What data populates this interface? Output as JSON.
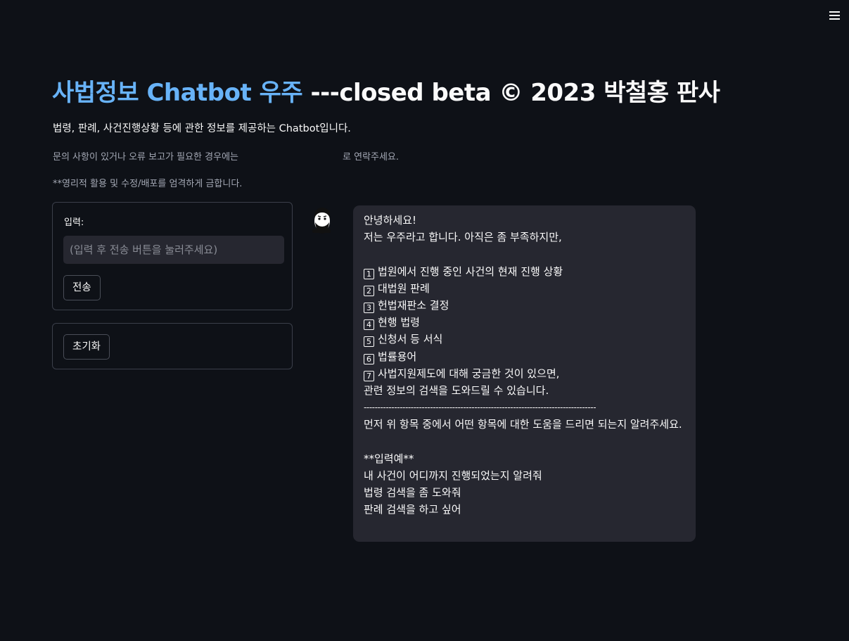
{
  "header": {
    "menu_icon": "hamburger-menu-icon"
  },
  "title": {
    "part1": "사법정보 Chatbot 우주",
    "part2": " ---closed beta © 2023 박철홍 판사",
    "accent_color": "#68b3f8"
  },
  "subtitle": "법령, 판례, 사건진행상황 등에 관한 정보를 제공하는 Chatbot입니다.",
  "contact": {
    "before": "문의 사항이 있거나 오류 보고가 필요한 경우에는",
    "after": "로 연락주세요."
  },
  "notice": "**영리적 활용 및 수정/배포를 엄격하게 금합니다.",
  "form": {
    "input_label": "입력:",
    "input_placeholder": "(입력 후 전송 버튼을 눌러주세요)",
    "input_value": "",
    "send_label": "전송"
  },
  "reset": {
    "label": "초기화"
  },
  "chat": {
    "avatar_icon": "bearded-man-avatar-icon",
    "greeting": "안녕하세요!",
    "intro": "저는 우주라고 합니다. 아직은 좀 부족하지만,",
    "items": [
      {
        "num": "1",
        "text": "법원에서 진행 중인 사건의 현재 진행 상황"
      },
      {
        "num": "2",
        "text": "대법원 판례"
      },
      {
        "num": "3",
        "text": "헌법재판소 결정"
      },
      {
        "num": "4",
        "text": "현행 법령"
      },
      {
        "num": "5",
        "text": "신청서 등 서식"
      },
      {
        "num": "6",
        "text": "법률용어"
      },
      {
        "num": "7",
        "text": "사법지원제도에 대해 궁금한 것이 있으면,"
      }
    ],
    "closing": "관련 정보의 검색을 도와드릴 수 있습니다.",
    "divider": "------------------------------------------------------------------------------------",
    "question": "먼저 위 항목 중에서 어떤 항목에 대한 도움을 드리면 되는지 알려주세요.",
    "example_header": "**입력예**",
    "examples": [
      "내 사건이 어디까지 진행되었는지 알려줘",
      "법령 검색을 좀 도와줘",
      "판례 검색을 하고 싶어"
    ]
  }
}
